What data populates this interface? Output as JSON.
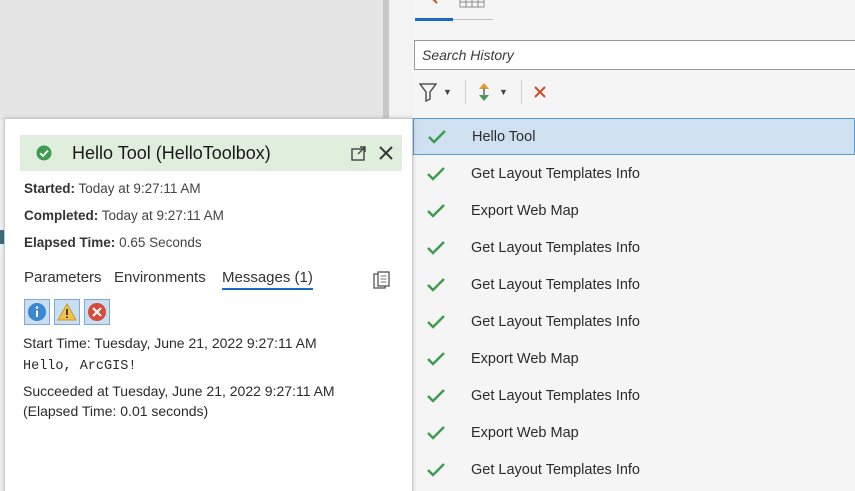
{
  "history": {
    "search_placeholder": "Search History",
    "items": [
      {
        "label": "Hello Tool",
        "selected": true
      },
      {
        "label": "Get Layout Templates Info"
      },
      {
        "label": "Export Web Map"
      },
      {
        "label": "Get Layout Templates Info"
      },
      {
        "label": "Get Layout Templates Info"
      },
      {
        "label": "Get Layout Templates Info"
      },
      {
        "label": "Export Web Map"
      },
      {
        "label": "Get Layout Templates Info"
      },
      {
        "label": "Export Web Map"
      },
      {
        "label": "Get Layout Templates Info"
      }
    ]
  },
  "popup": {
    "title": "Hello Tool (HelloToolbox)",
    "started_label": "Started:",
    "started_value": "Today at 9:27:11 AM",
    "completed_label": "Completed:",
    "completed_value": "Today at 9:27:11 AM",
    "elapsed_label": "Elapsed Time:",
    "elapsed_value": "0.65 Seconds",
    "tabs": {
      "parameters": "Parameters",
      "environments": "Environments",
      "messages": "Messages (1)"
    },
    "messages": [
      "Start Time: Tuesday, June 21, 2022 9:27:11 AM",
      "Hello, ArcGIS!",
      "Succeeded at Tuesday, June 21, 2022 9:27:11 AM",
      "(Elapsed Time: 0.01 seconds)"
    ]
  },
  "colors": {
    "accent": "#1b6ac9",
    "success": "#3e9b4f",
    "selection": "#cfe0f0",
    "header_bg": "#dfeedd"
  }
}
